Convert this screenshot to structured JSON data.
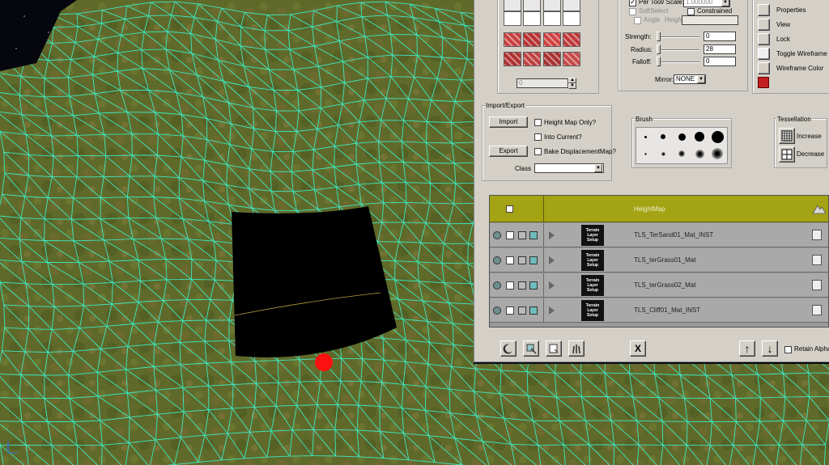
{
  "colors": {
    "wire": "#3ee8c0",
    "panel": "#d4d0c8",
    "heightmap_header": "#a3a314",
    "marker": "#ff1010"
  },
  "import_export": {
    "group_label": "Import/Export",
    "import_button": "Import",
    "export_button": "Export",
    "height_map_only": "Height Map Only?",
    "into_current": "Into Current?",
    "bake_displacement": "Bake DisplacementMap?",
    "class_label": "Class",
    "class_value": ""
  },
  "tool_settings": {
    "per_tool_scale": "Per Tool/ Scale:",
    "scale_value": "1.000000",
    "soft_select": "SoftSelect",
    "constrained": "Constrained",
    "angle": "Angle",
    "height": "Height",
    "strength_label": "Strength:",
    "strength_value": "0",
    "radius_label": "Radius:",
    "radius_value": "28",
    "falloff_label": "Falloff:",
    "falloff_value": "0",
    "mirror_label": "Mirror:",
    "mirror_value": "NONE"
  },
  "tools": {
    "numeric_field": "0"
  },
  "right_menu": [
    "Properties",
    "View",
    "Lock",
    "Toggle Wireframe on",
    "Wireframe Color"
  ],
  "brush": {
    "label": "Brush",
    "sizes": [
      3,
      6,
      9,
      12,
      15
    ],
    "soft_sizes": [
      3,
      5,
      8,
      11,
      14
    ]
  },
  "tessellation": {
    "label": "Tessellation",
    "increase": "Increase",
    "decrease": "Decrease"
  },
  "layers": {
    "header": "HeightMap",
    "thumb_text": "Terrain Layer Setup",
    "rows": [
      "TLS_TerSand01_Mat_INST",
      "TLS_terGrass01_Mat",
      "TLS_terGrass02_Mat",
      "TLS_Cliff01_Mat_INST"
    ]
  },
  "bottom_bar": {
    "close_glyph": "X",
    "retain_alpha": "Retain Alpha?",
    "up_glyph": "↑",
    "down_glyph": "↓"
  }
}
